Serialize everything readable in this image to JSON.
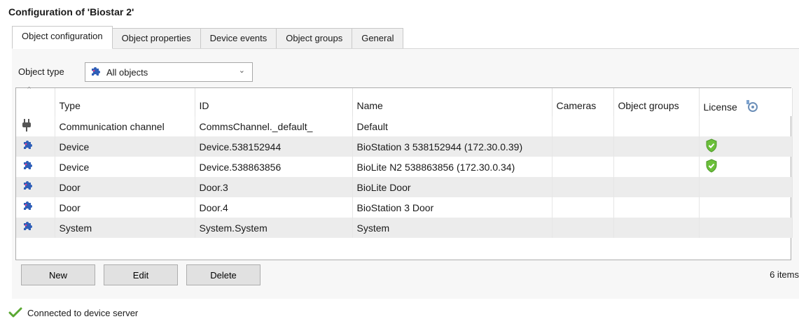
{
  "window": {
    "title": "Configuration of 'Biostar 2'"
  },
  "tabs": [
    {
      "label": "Object configuration",
      "active": true
    },
    {
      "label": "Object properties",
      "active": false
    },
    {
      "label": "Device events",
      "active": false
    },
    {
      "label": "Object groups",
      "active": false
    },
    {
      "label": "General",
      "active": false
    }
  ],
  "filter": {
    "label": "Object type",
    "selected": "All objects"
  },
  "table": {
    "columns": [
      "Type",
      "ID",
      "Name",
      "Cameras",
      "Object groups",
      "License"
    ],
    "rows": [
      {
        "icon": "plug-icon",
        "type": "Communication channel",
        "id": "CommsChannel._default_",
        "name": "Default",
        "cameras": "",
        "object_groups": "",
        "license": ""
      },
      {
        "icon": "puzzle-icon",
        "type": "Device",
        "id": "Device.538152944",
        "name": "BioStation 3 538152944 (172.30.0.39)",
        "cameras": "",
        "object_groups": "",
        "license": "shield-check-icon"
      },
      {
        "icon": "puzzle-icon",
        "type": "Device",
        "id": "Device.538863856",
        "name": "BioLite N2 538863856 (172.30.0.34)",
        "cameras": "",
        "object_groups": "",
        "license": "shield-check-icon"
      },
      {
        "icon": "puzzle-icon",
        "type": "Door",
        "id": "Door.3",
        "name": "BioLite Door",
        "cameras": "",
        "object_groups": "",
        "license": ""
      },
      {
        "icon": "puzzle-icon",
        "type": "Door",
        "id": "Door.4",
        "name": "BioStation 3 Door",
        "cameras": "",
        "object_groups": "",
        "license": ""
      },
      {
        "icon": "puzzle-icon",
        "type": "System",
        "id": "System.System",
        "name": "System",
        "cameras": "",
        "object_groups": "",
        "license": ""
      }
    ]
  },
  "buttons": {
    "new": "New",
    "edit": "Edit",
    "delete": "Delete"
  },
  "item_count": "6 items",
  "status": {
    "text": "Connected to device server"
  },
  "colors": {
    "puzzle": "#2f5fb8",
    "shield": "#6bbf3a",
    "check": "#5aa832"
  }
}
